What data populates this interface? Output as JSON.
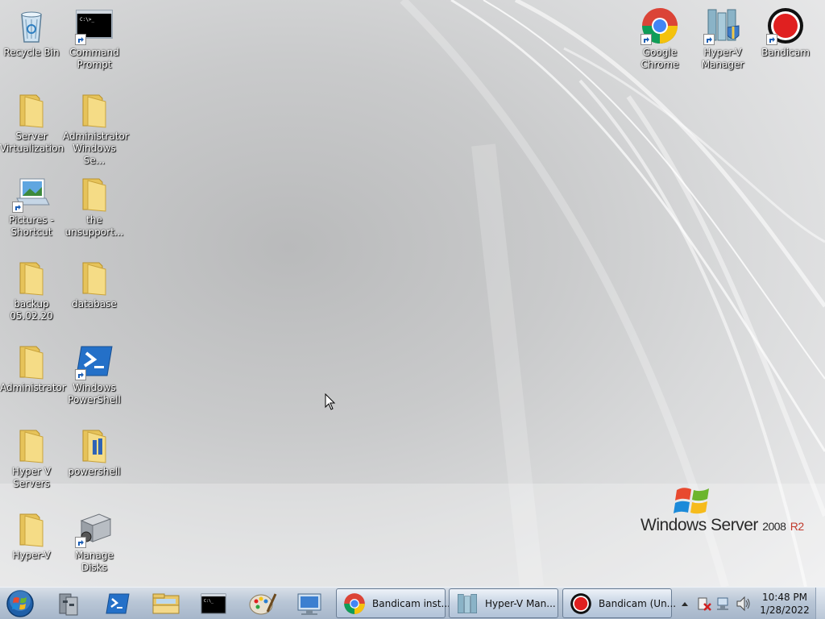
{
  "desktop": {
    "icons_left": [
      {
        "label": "Recycle Bin",
        "icon": "recycle-bin-icon"
      },
      {
        "label": "Command Prompt",
        "icon": "cmd-icon"
      },
      {
        "label": "Server Virtualization",
        "icon": "folder-icon"
      },
      {
        "label": "Administrator Windows Se...",
        "icon": "folder-icon"
      },
      {
        "label": "Pictures - Shortcut",
        "icon": "pictures-icon"
      },
      {
        "label": "the unsupport...",
        "icon": "folder-icon"
      },
      {
        "label": "backup 05.02.20",
        "icon": "folder-icon"
      },
      {
        "label": "database",
        "icon": "folder-icon"
      },
      {
        "label": "Administrator",
        "icon": "folder-icon"
      },
      {
        "label": "Windows PowerShell",
        "icon": "powershell-icon"
      },
      {
        "label": "Hyper V Servers",
        "icon": "folder-icon"
      },
      {
        "label": "powershell",
        "icon": "folder-icon"
      },
      {
        "label": "Hyper-V",
        "icon": "folder-icon"
      },
      {
        "label": "Manage Disks",
        "icon": "disk-icon"
      }
    ],
    "icons_right": [
      {
        "label": "Google Chrome",
        "icon": "chrome-icon"
      },
      {
        "label": "Hyper-V Manager",
        "icon": "hyperv-icon"
      },
      {
        "label": "Bandicam",
        "icon": "bandicam-icon"
      }
    ],
    "logo": {
      "brand": "Windows Server",
      "version": "2008",
      "edition": "R2"
    }
  },
  "taskbar": {
    "tasks": [
      {
        "label": "Bandicam inst...",
        "icon": "chrome-icon"
      },
      {
        "label": "Hyper-V Man...",
        "icon": "hyperv-icon"
      },
      {
        "label": "Bandicam (Un...",
        "icon": "bandicam-icon"
      }
    ],
    "clock": {
      "time": "10:48 PM",
      "date": "1/28/2022"
    }
  }
}
